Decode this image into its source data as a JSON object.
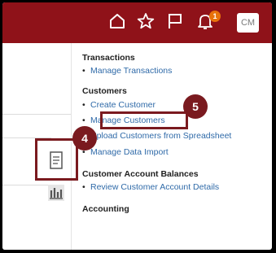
{
  "header": {
    "notification_count": "1",
    "avatar_initials": "CM"
  },
  "menu": {
    "transactions": {
      "heading": "Transactions",
      "items": [
        "Manage Transactions"
      ]
    },
    "customers": {
      "heading": "Customers",
      "items": [
        "Create Customer",
        "Manage Customers",
        "Upload Customers from Spreadsheet",
        "Manage Data Import"
      ]
    },
    "customer_account_balances": {
      "heading": "Customer Account Balances",
      "items": [
        "Review Customer Account Details"
      ]
    },
    "accounting": {
      "heading": "Accounting"
    }
  },
  "callouts": {
    "step4": "4",
    "step5": "5"
  },
  "colors": {
    "brand_bar": "#8f1219",
    "link": "#2f6aa8",
    "callout": "#7a1a1f",
    "badge": "#e8720b"
  }
}
